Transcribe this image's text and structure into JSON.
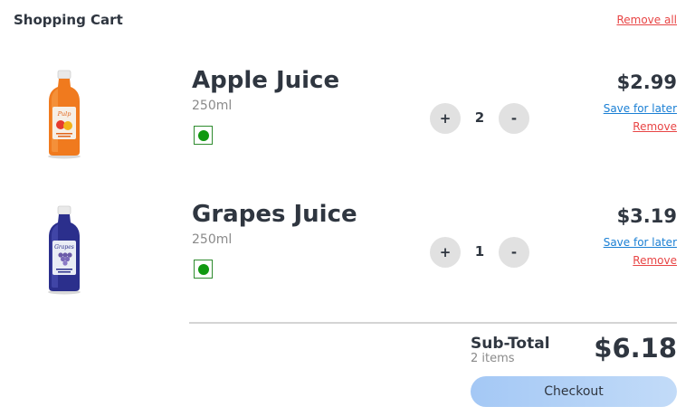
{
  "header": {
    "title": "Shopping Cart",
    "remove_all_label": "Remove all"
  },
  "items": [
    {
      "name": "Apple Juice",
      "size": "250ml",
      "price": "$2.99",
      "quantity": "2",
      "plus_label": "+",
      "minus_label": "-",
      "save_label": "Save for later",
      "remove_label": "Remove",
      "bottle_color": "#f07a1e"
    },
    {
      "name": "Grapes Juice",
      "size": "250ml",
      "price": "$3.19",
      "quantity": "1",
      "plus_label": "+",
      "minus_label": "-",
      "save_label": "Save for later",
      "remove_label": "Remove",
      "bottle_color": "#2b2f8c"
    }
  ],
  "summary": {
    "label": "Sub-Total",
    "items_count": "2 items",
    "total": "$6.18",
    "checkout_label": "Checkout"
  },
  "colors": {
    "link_blue": "#1a7fd4",
    "remove_red": "#e84545",
    "veg_green": "#119911",
    "checkout_blue": "#a4c8f5"
  }
}
